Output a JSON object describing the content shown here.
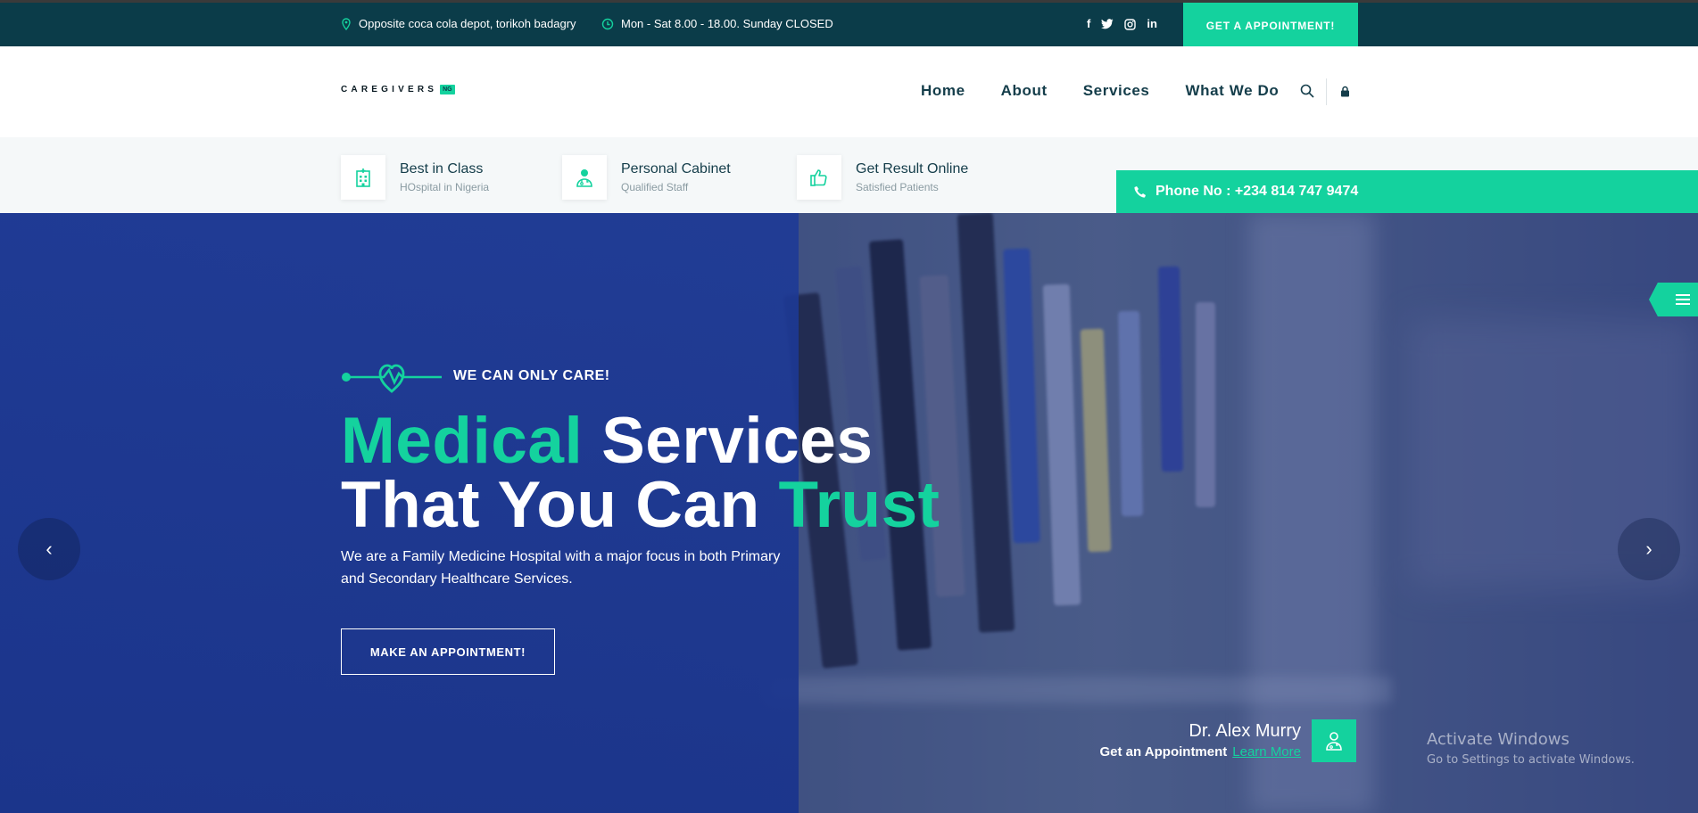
{
  "topbar": {
    "address": "Opposite coca cola depot, torikoh badagry",
    "hours": "Mon - Sat 8.00 - 18.00. Sunday CLOSED",
    "social": [
      "f",
      "t",
      "ig",
      "in"
    ],
    "appointment_button": "GET A APPOINTMENT!"
  },
  "header": {
    "logo_text": "CAREGIVERS",
    "logo_badge": "NG",
    "nav": [
      "Home",
      "About",
      "Services",
      "What We Do"
    ],
    "icons": [
      "search-icon",
      "lock-icon"
    ]
  },
  "features": [
    {
      "title": "Best in Class",
      "subtitle": "HOspital in Nigeria",
      "icon": "hospital-icon"
    },
    {
      "title": "Personal Cabinet",
      "subtitle": "Qualified Staff",
      "icon": "doctor-icon"
    },
    {
      "title": "Get Result Online",
      "subtitle": "Satisfied Patients",
      "icon": "thumbs-up-icon"
    }
  ],
  "phone": "Phone No : +234 814 747 9474",
  "hero": {
    "tagline": "WE CAN ONLY CARE!",
    "headline": {
      "line1_green": "Medical",
      "line1_white": "Services",
      "line2_white": "That You Can",
      "line2_green": "Trust"
    },
    "description": "We are a Family Medicine Hospital with a major focus in both Primary and Secondary Healthcare Services.",
    "cta": "MAKE AN APPOINTMENT!",
    "prev_arrow": "‹",
    "next_arrow": "›"
  },
  "doctor": {
    "name": "Dr. Alex Murry",
    "appointment_text": "Get an Appointment",
    "link": "Learn More"
  },
  "watermark": {
    "title": "Activate Windows",
    "subtitle": "Go to Settings to activate Windows."
  },
  "colors": {
    "accent": "#14d29e",
    "topbar": "#0b3c49",
    "hero_blue": "#1e3a96",
    "nav_text": "#143d4a"
  }
}
